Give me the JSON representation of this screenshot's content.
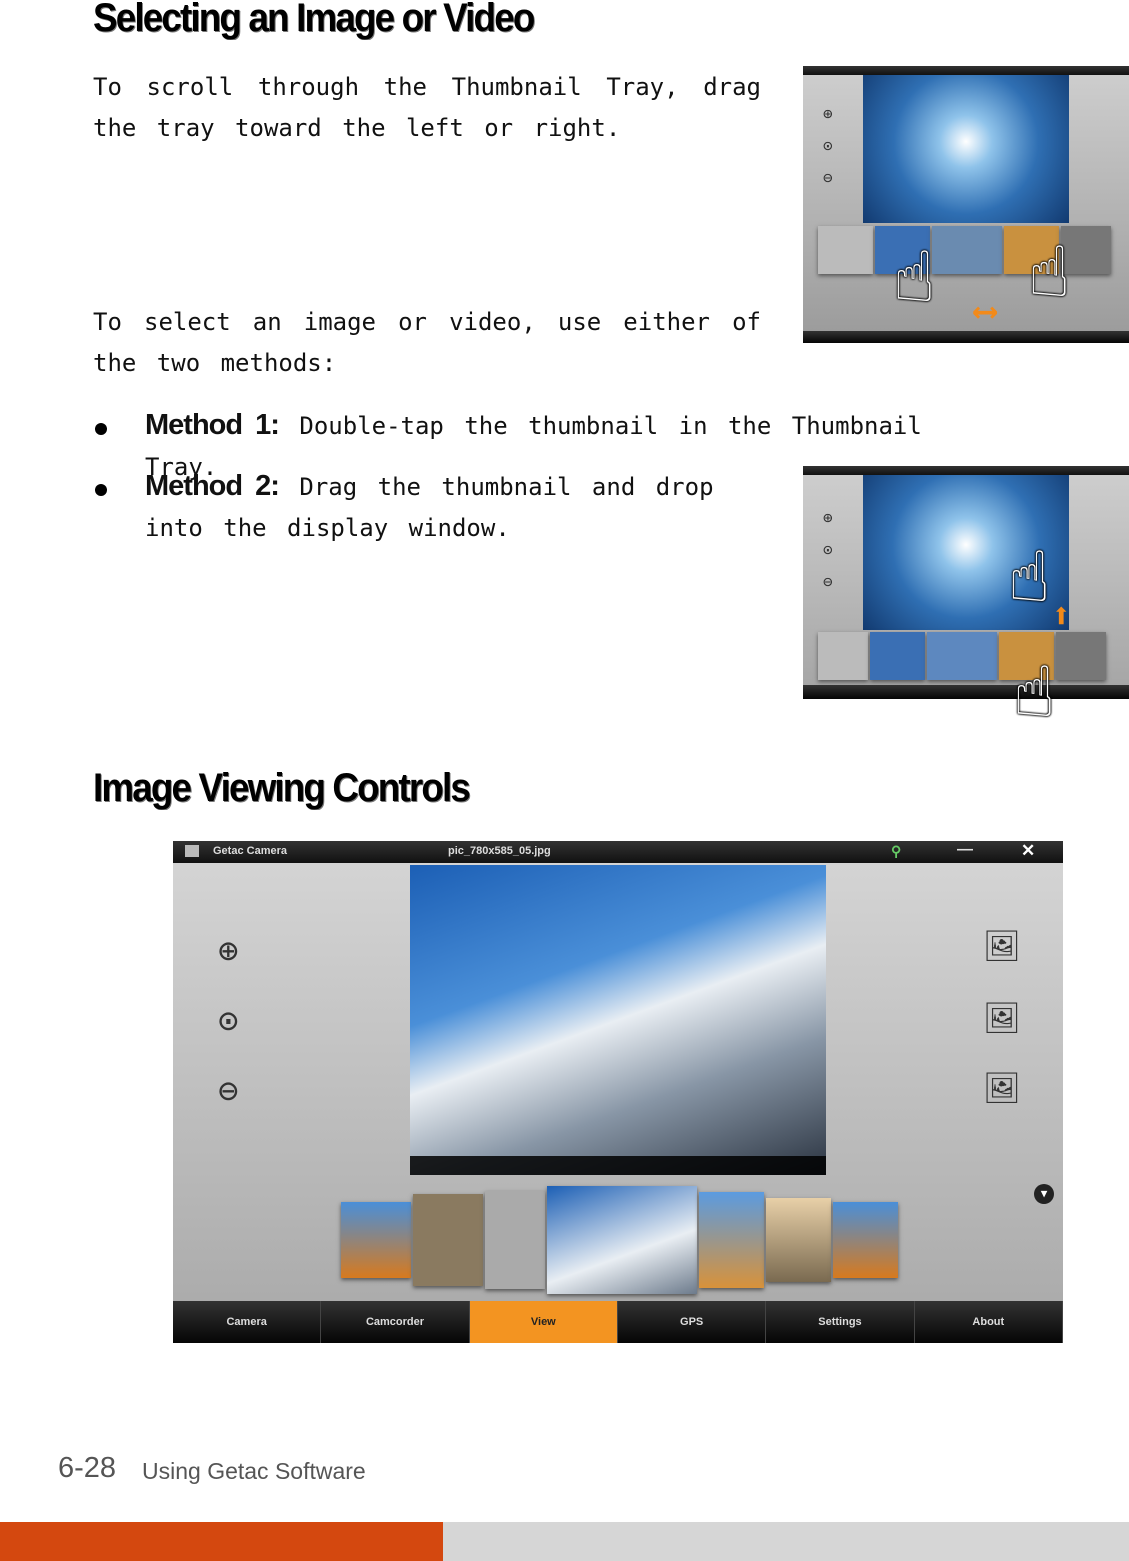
{
  "section1": {
    "heading": "Selecting an Image or Video",
    "para1": "To scroll through the Thumbnail Tray, drag the tray toward the left or right.",
    "para2": "To select an image or video, use either of the two methods:",
    "methods": [
      {
        "label": "Method 1:",
        "text": "Double-tap the thumbnail in the Thumbnail Tray."
      },
      {
        "label": "Method 2:",
        "text": "Drag the thumbnail and drop into the display window."
      }
    ]
  },
  "section2": {
    "heading": "Image Viewing Controls",
    "app": {
      "title": "Getac Camera",
      "filename": "pic_780x585_05.jpg",
      "nav": [
        "Camera",
        "Camcorder",
        "View",
        "GPS",
        "Settings",
        "About"
      ],
      "active_nav": "View",
      "left_icons": [
        "zoom-in-icon",
        "zoom-fit-icon",
        "zoom-out-icon"
      ],
      "right_icons": [
        "rotate-right-icon",
        "image-info-icon",
        "rotate-left-icon"
      ]
    }
  },
  "footer": {
    "page_number": "6-28",
    "title": "Using Getac Software"
  },
  "colors": {
    "accent_bar": "#d4480f",
    "gray_bar": "#d6d6d6",
    "active_tab": "#f39421"
  }
}
